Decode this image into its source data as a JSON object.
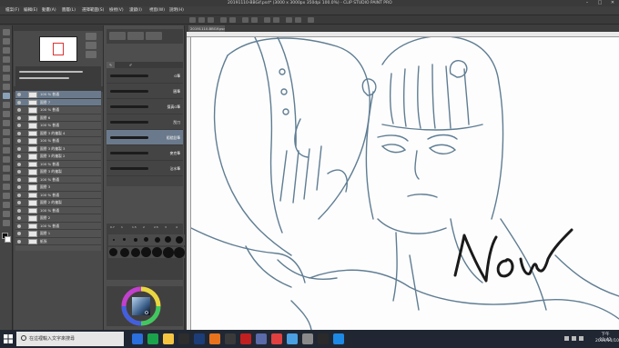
{
  "window": {
    "title": "20191110-BBGif.psd* (3000 x 3000px 350dpi 100.0%) - CLIP STUDIO PAINT PRO",
    "controls": [
      "–",
      "□",
      "✕"
    ]
  },
  "menu": [
    "檔案(F)",
    "編輯(E)",
    "動畫(A)",
    "圖層(L)",
    "選擇範圍(S)",
    "檢視(V)",
    "濾鏡(I)",
    "視窗(W)",
    "說明(H)"
  ],
  "canvas": {
    "tab_label": "20191110-BBGif.psd"
  },
  "layers": [
    {
      "name": "100 % 普通"
    },
    {
      "name": "圖層 7"
    },
    {
      "name": "100 % 普通"
    },
    {
      "name": "圖層 6"
    },
    {
      "name": "100 % 普通"
    },
    {
      "name": "圖層 3 的複製 4"
    },
    {
      "name": "100 % 普通"
    },
    {
      "name": "圖層 3 的複製 3"
    },
    {
      "name": "圖層 3 的複製 2"
    },
    {
      "name": "100 % 普通"
    },
    {
      "name": "圖層 3 的複製"
    },
    {
      "name": "100 % 普通"
    },
    {
      "name": "圖層 3"
    },
    {
      "name": "100 % 普通"
    },
    {
      "name": "圖層 2 的複製"
    },
    {
      "name": "100 % 普通"
    },
    {
      "name": "圖層 2"
    },
    {
      "name": "100 % 普通"
    },
    {
      "name": "圖層 1"
    },
    {
      "name": "紙張"
    }
  ],
  "brushes": [
    {
      "name": "G筆"
    },
    {
      "name": "圓筆"
    },
    {
      "name": "擬真G筆"
    },
    {
      "name": "刮刀"
    },
    {
      "name": "粗糙鉛筆"
    },
    {
      "name": "麥克筆"
    },
    {
      "name": "沾水筆"
    }
  ],
  "brush_sizes": [
    "0.7",
    "1",
    "1.5",
    "2",
    "2.5",
    "3",
    "4"
  ],
  "taskbar": {
    "search_placeholder": "在這裡輸入文字來搜尋",
    "time": "下午 11:42",
    "date": "2019/11/10"
  },
  "handwriting": "Now",
  "colors": {
    "sketch": "#5f7d93",
    "accent_selected": "#6a7a8c"
  }
}
